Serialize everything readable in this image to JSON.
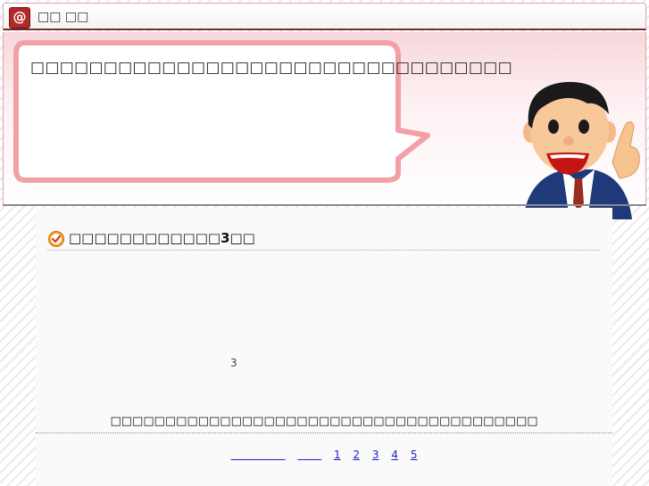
{
  "window": {
    "icon_name": "at-sign-icon",
    "icon_glyph": "@",
    "title": "□□ □□"
  },
  "hero": {
    "bubble_text": "□□□□□□□□□□□□□□□□□□□□□□□□□□□□□□□□□",
    "avatar_name": "businessman-pointing-icon"
  },
  "section": {
    "icon_name": "check-circle-icon",
    "title": "□□□□□□□□□□□□3□□"
  },
  "body": {
    "step_number": "3",
    "footer_text": "□□□□□□□□□□□□□□□□□□□□□□□□□□□□□□□□□□□□□□□"
  },
  "pager": {
    "link_a": "                ",
    "link_b": "       ",
    "pages": [
      "1",
      "2",
      "3",
      "4",
      "5"
    ]
  },
  "colors": {
    "accent": "#b02a2a",
    "title_rule": "#7a2a2f",
    "bubble_border": "#f2a0a6",
    "link": "#1f1fcc"
  }
}
